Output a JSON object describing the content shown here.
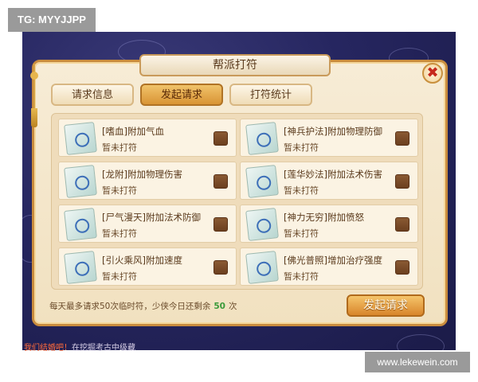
{
  "overlay_tag": "TG: MYYJJPP",
  "watermark": "www.lekewein.com",
  "dialog": {
    "title": "帮派打符",
    "close_icon": "close-icon",
    "close_label": "✖"
  },
  "tabs": [
    {
      "label": "请求信息",
      "active": false
    },
    {
      "label": "发起请求",
      "active": true
    },
    {
      "label": "打符统计",
      "active": false
    }
  ],
  "items": [
    {
      "name": "[嗜血]附加气血",
      "status": "暂未打符",
      "checked": false,
      "icon": "talisman-icon"
    },
    {
      "name": "[神兵护法]附加物理防御",
      "status": "暂未打符",
      "checked": false,
      "icon": "talisman-icon"
    },
    {
      "name": "[龙附]附加物理伤害",
      "status": "暂未打符",
      "checked": false,
      "icon": "talisman-icon"
    },
    {
      "name": "[莲华妙法]附加法术伤害",
      "status": "暂未打符",
      "checked": false,
      "icon": "talisman-icon"
    },
    {
      "name": "[尸气漫天]附加法术防御",
      "status": "暂未打符",
      "checked": false,
      "icon": "talisman-icon"
    },
    {
      "name": "[神力无穷]附加愤怒",
      "status": "暂未打符",
      "checked": false,
      "icon": "talisman-icon"
    },
    {
      "name": "[引火乘风]附加速度",
      "status": "暂未打符",
      "checked": false,
      "icon": "talisman-icon"
    },
    {
      "name": "[佛光普照]增加治疗强度",
      "status": "暂未打符",
      "checked": false,
      "icon": "talisman-icon"
    }
  ],
  "footer": {
    "note_prefix": "每天最多请求50次临时符，少侠今日还剩余",
    "remaining": "50",
    "note_suffix": "次",
    "submit_label": "发起请求"
  },
  "chat": {
    "highlight": "我们结婚吧！",
    "text": "在挖掘考古中级藏"
  },
  "colors": {
    "accent": "#d99435",
    "remaining_count": "#3a9a3a",
    "checkbox": "#6b3f1f"
  }
}
